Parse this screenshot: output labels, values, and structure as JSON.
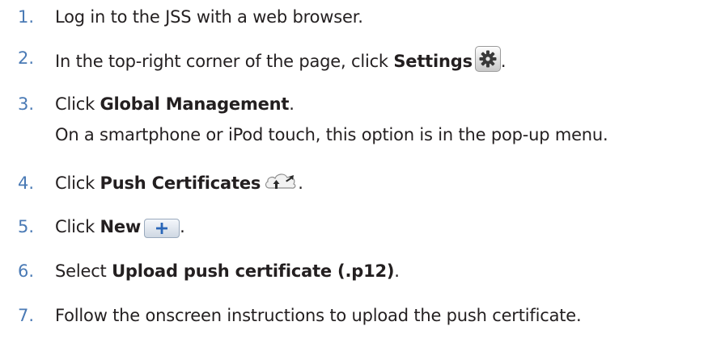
{
  "steps": [
    {
      "num": "1.",
      "text": "Log in to the JSS with a web browser."
    },
    {
      "num": "2.",
      "pre": "In the top-right corner of the page, click ",
      "bold": "Settings",
      "post": ".",
      "icon": "gear-icon"
    },
    {
      "num": "3.",
      "pre": "Click ",
      "bold": "Global Management",
      "post": ".",
      "sub": "On a smartphone or iPod touch, this option is in the pop-up menu."
    },
    {
      "num": "4.",
      "pre": "Click ",
      "bold": "Push Certificates",
      "post": ".",
      "icon": "cloud-upload-icon"
    },
    {
      "num": "5.",
      "pre": "Click ",
      "bold": "New",
      "post": ".",
      "icon": "plus-icon"
    },
    {
      "num": "6.",
      "pre": "Select ",
      "bold": "Upload push certificate (.p12)",
      "post": "."
    },
    {
      "num": "7.",
      "text": "Follow the onscreen instructions to upload the push certificate."
    }
  ],
  "colors": {
    "number": "#4a7ab5",
    "text": "#231f20",
    "plus": "#2a66b8"
  }
}
